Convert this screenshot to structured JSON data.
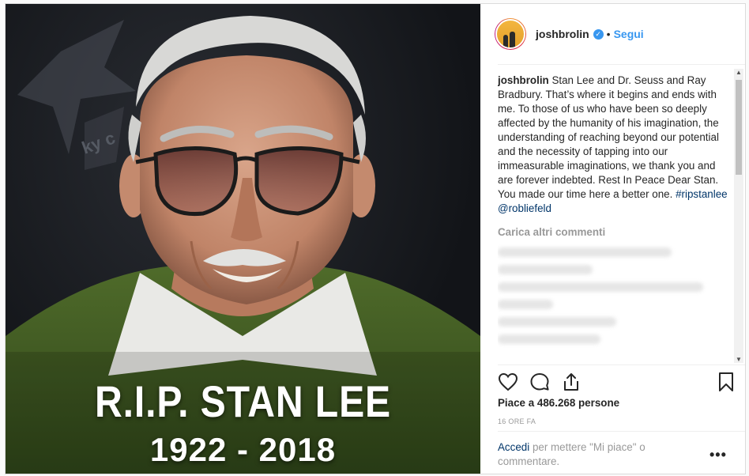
{
  "image": {
    "headline": "R.I.P. STAN LEE",
    "years": "1922 - 2018"
  },
  "header": {
    "username": "joshbrolin",
    "separator": "•",
    "follow_label": "Segui",
    "avatar_icon": "avatar-icon",
    "verified_icon": "verified-badge-icon"
  },
  "caption": {
    "username": "joshbrolin",
    "text": "Stan Lee and Dr. Seuss and Ray Bradbury. That’s where it begins and ends with me. To those of us who have been so deeply affected by the humanity of his imagination, the understanding of reaching beyond our potential and the necessity of tapping into our immeasurable imaginations, we thank you and are forever indebted. Rest In Peace Dear Stan. You made our time here a better one.",
    "hashtag": "#ripstanlee",
    "mention": "@robliefeld"
  },
  "comments": {
    "load_more": "Carica altri commenti"
  },
  "actions": {
    "like_icon": "heart-icon",
    "comment_icon": "comment-icon",
    "share_icon": "share-icon",
    "save_icon": "bookmark-icon"
  },
  "likes": "Piace a 486.268 persone",
  "timestamp": "16 ORE FA",
  "login_prompt": {
    "link": "Accedi",
    "text": "per mettere \"Mi piace\" o commentare."
  },
  "more_options": "•••",
  "colors": {
    "accent": "#3897f0",
    "link": "#003569",
    "muted": "#999999"
  }
}
